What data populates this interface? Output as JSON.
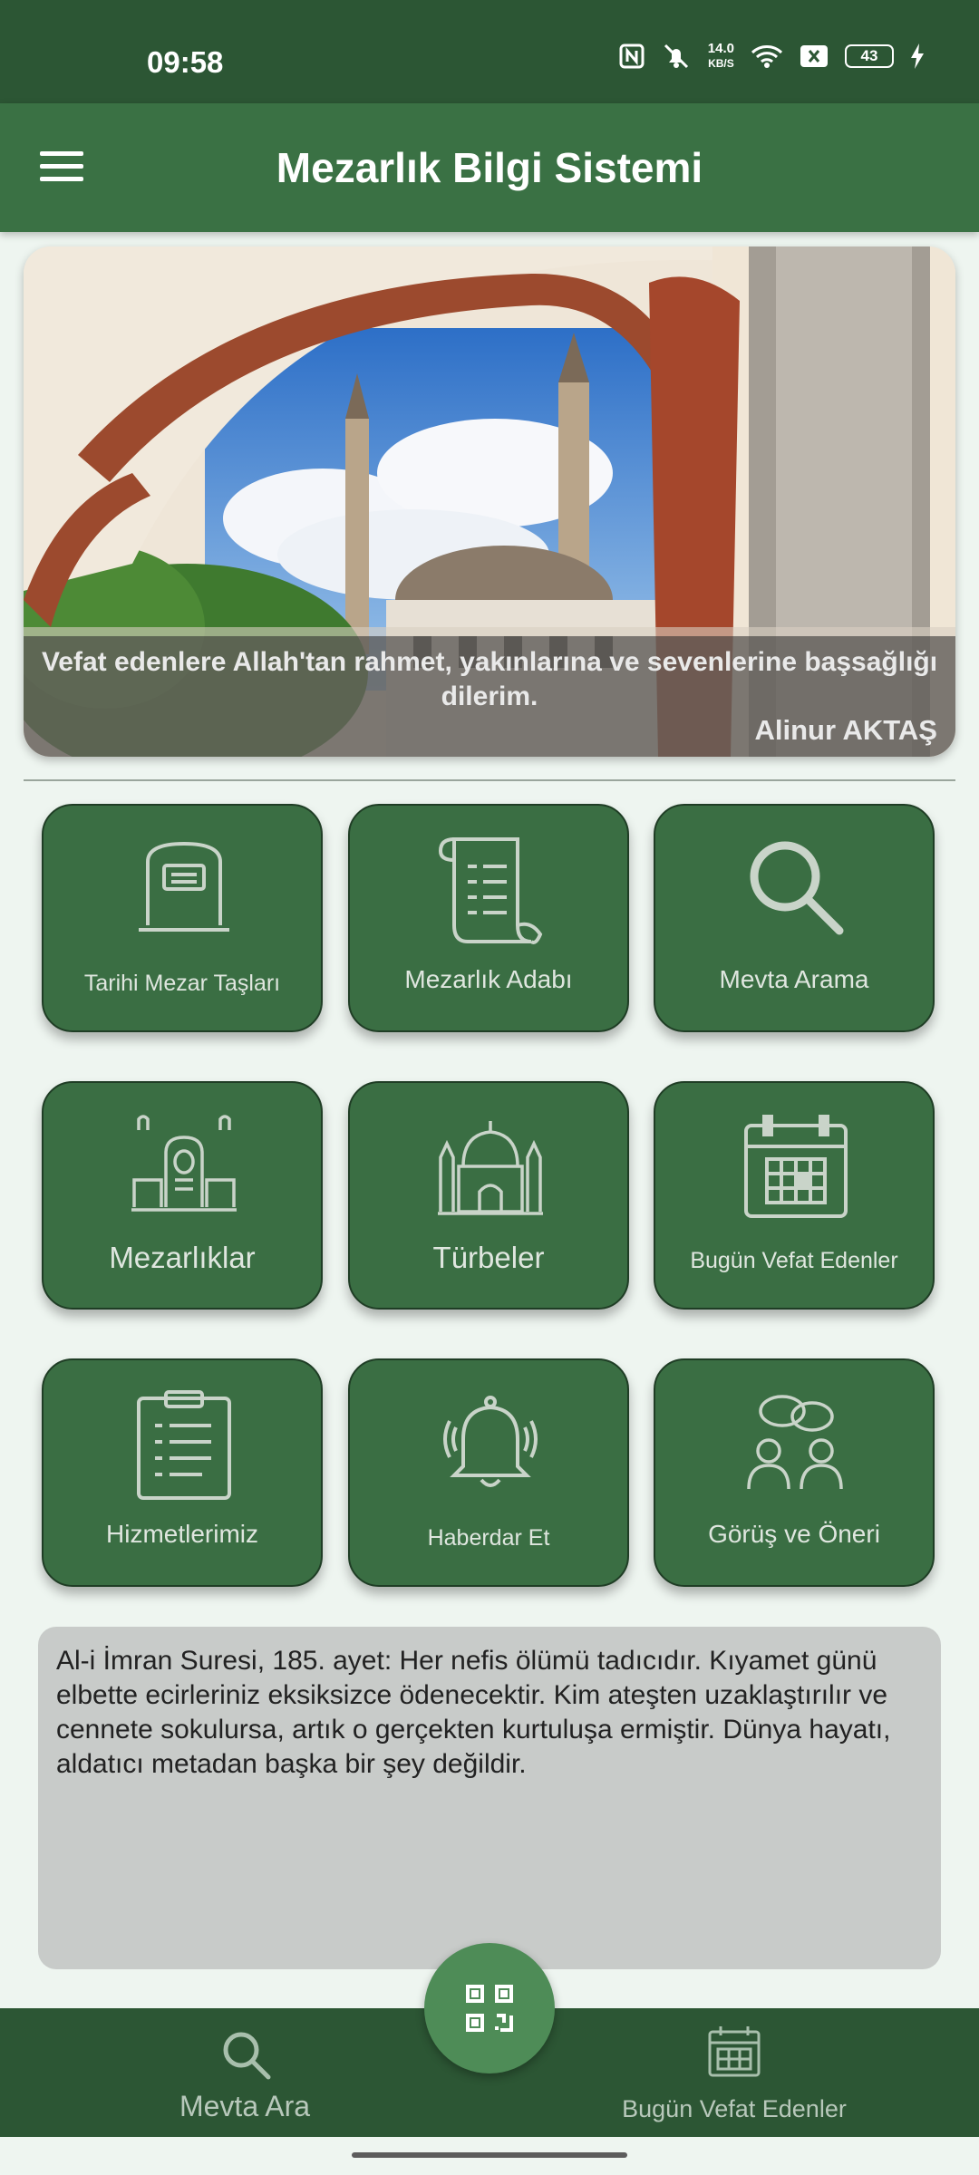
{
  "status_bar": {
    "time": "09:58",
    "net_speed_top": "14.0",
    "net_speed_unit": "KB/S",
    "battery": "43"
  },
  "app_bar": {
    "title": "Mezarlık Bilgi Sistemi"
  },
  "banner": {
    "quote": "Vefat edenlere Allah'tan rahmet, yakınlarına ve sevenlerine başsağlığı dilerim.",
    "author": "Alinur AKTAŞ"
  },
  "tiles": [
    {
      "label": "Tarihi Mezar Taşları",
      "icon": "gravestone-icon"
    },
    {
      "label": "Mezarlık Adabı",
      "icon": "scroll-icon"
    },
    {
      "label": "Mevta Arama",
      "icon": "search-icon"
    },
    {
      "label": "Mezarlıklar",
      "icon": "cemetery-icon"
    },
    {
      "label": "Türbeler",
      "icon": "mosque-icon"
    },
    {
      "label": "Bugün Vefat Edenler",
      "icon": "calendar-icon"
    },
    {
      "label": "Hizmetlerimiz",
      "icon": "clipboard-icon"
    },
    {
      "label": "Haberdar Et",
      "icon": "bell-icon"
    },
    {
      "label": "Görüş ve Öneri",
      "icon": "feedback-icon"
    }
  ],
  "verse": "Al-i İmran Suresi, 185. ayet: Her nefis ölümü tadıcıdır. Kıyamet günü elbette ecirleriniz eksiksizce ödenecektir. Kim ateşten uzaklaştırılır ve cennete sokulursa, artık o gerçekten kurtuluşa ermiştir. Dünya hayatı, aldatıcı metadan başka bir şey değildir.",
  "bottom_nav": {
    "left_label": "Mevta Ara",
    "right_label": "Bugün Vefat Edenler",
    "fab_icon": "qr-code-icon"
  },
  "colors": {
    "primary": "#3a7144",
    "dark": "#2c5634",
    "tile": "#3a6e43",
    "fab": "#4e8c57"
  }
}
